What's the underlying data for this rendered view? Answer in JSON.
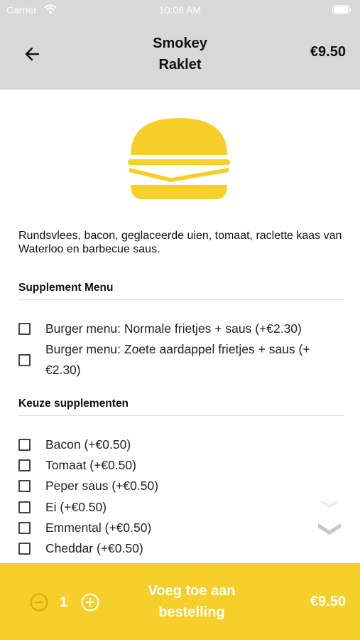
{
  "status_bar": {
    "carrier": "Carrier",
    "time": "10:08 AM"
  },
  "header": {
    "title": "Smokey\nRaklet",
    "price": "€9.50",
    "back_icon": "arrow-left-icon"
  },
  "product": {
    "icon": "burger-icon",
    "icon_color": "#f7cf2a",
    "description": "Rundsvlees, bacon, geglaceerde uien, tomaat, raclette kaas van Waterloo en barbecue saus."
  },
  "sections": [
    {
      "title": "Supplement Menu",
      "options": [
        {
          "label": "Burger menu: Normale frietjes + saus (+€2.30)",
          "checked": false
        },
        {
          "label": "Burger menu: Zoete aardappel frietjes + saus (+€2.30)",
          "checked": false
        }
      ]
    },
    {
      "title": "Keuze supplementen",
      "options": [
        {
          "label": "Bacon (+€0.50)",
          "checked": false
        },
        {
          "label": "Tomaat (+€0.50)",
          "checked": false
        },
        {
          "label": "Peper saus (+€0.50)",
          "checked": false
        },
        {
          "label": "Ei (+€0.50)",
          "checked": false
        },
        {
          "label": "Emmental (+€0.50)",
          "checked": false
        },
        {
          "label": "Cheddar (+€0.50)",
          "checked": false
        }
      ]
    }
  ],
  "footer": {
    "quantity": "1",
    "add_label": "Voeg toe aan\nbestelling",
    "price": "€9.50",
    "accent": "#f7cf2a"
  }
}
